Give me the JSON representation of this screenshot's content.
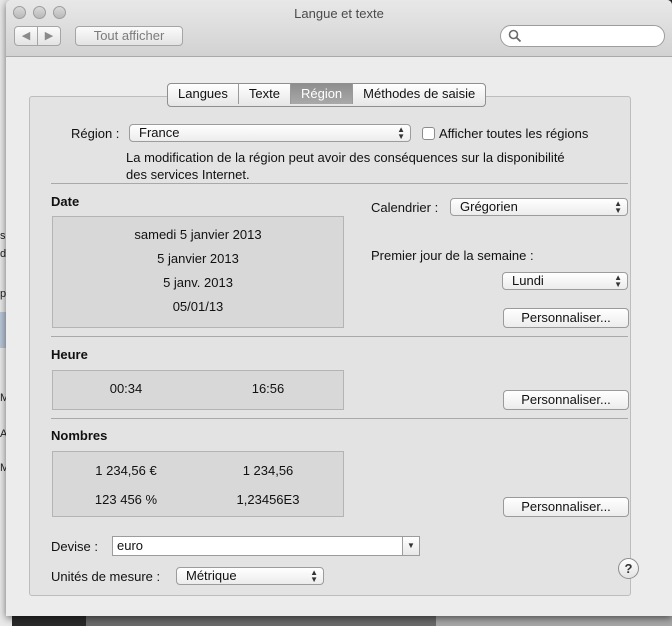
{
  "window": {
    "title": "Langue et texte"
  },
  "toolbar": {
    "back_icon": "chevron-left-icon",
    "forward_icon": "chevron-right-icon",
    "show_all_label": "Tout afficher",
    "search_placeholder": ""
  },
  "tabs": [
    {
      "label": "Langues",
      "active": false
    },
    {
      "label": "Texte",
      "active": false
    },
    {
      "label": "Région",
      "active": true
    },
    {
      "label": "Méthodes de saisie",
      "active": false
    }
  ],
  "region": {
    "label": "Région :",
    "value": "France",
    "show_all_label": "Afficher toutes les régions",
    "show_all_checked": false,
    "note_line1": "La modification de la région peut avoir des conséquences sur la disponibilité",
    "note_line2": "des services Internet."
  },
  "date": {
    "heading": "Date",
    "formats": [
      "samedi 5 janvier 2013",
      "5 janvier 2013",
      "5 janv. 2013",
      "05/01/13"
    ],
    "calendar_label": "Calendrier :",
    "calendar_value": "Grégorien",
    "first_day_label": "Premier jour de la semaine :",
    "first_day_value": "Lundi",
    "customize_label": "Personnaliser..."
  },
  "time": {
    "heading": "Heure",
    "short": "00:34",
    "long": "16:56",
    "customize_label": "Personnaliser..."
  },
  "numbers": {
    "heading": "Nombres",
    "currency": "1 234,56 €",
    "decimal": "1 234,56",
    "percent": "123 456 %",
    "scientific": "1,23456E3",
    "customize_label": "Personnaliser..."
  },
  "currency": {
    "label": "Devise :",
    "value": "euro"
  },
  "units": {
    "label": "Unités de mesure :",
    "value": "Métrique"
  },
  "help": {
    "label": "?"
  },
  "background_fragments": [
    "s",
    "du",
    "p",
    "M",
    "A",
    "M"
  ],
  "colors": {
    "active_tab": "#999999",
    "panel": "#e3e3e3",
    "window": "#ececec"
  }
}
